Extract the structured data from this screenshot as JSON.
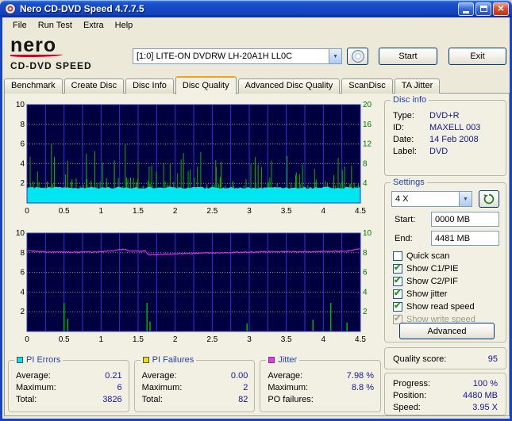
{
  "window": {
    "title": "Nero CD-DVD Speed 4.7.7.5"
  },
  "menu": {
    "items": [
      "File",
      "Run Test",
      "Extra",
      "Help"
    ]
  },
  "logo": {
    "brand": "nero",
    "product": "CD-DVD SPEED"
  },
  "toolbar": {
    "drive": "[1:0]  LITE-ON DVDRW LH-20A1H LL0C",
    "start": "Start",
    "exit": "Exit"
  },
  "tabs": [
    {
      "label": "Benchmark",
      "active": false
    },
    {
      "label": "Create Disc",
      "active": false
    },
    {
      "label": "Disc Info",
      "active": false
    },
    {
      "label": "Disc Quality",
      "active": true
    },
    {
      "label": "Advanced Disc Quality",
      "active": false
    },
    {
      "label": "ScanDisc",
      "active": false
    },
    {
      "label": "TA Jitter",
      "active": false
    }
  ],
  "disc_info": {
    "title": "Disc info",
    "rows": [
      {
        "label": "Type:",
        "value": "DVD+R"
      },
      {
        "label": "ID:",
        "value": "MAXELL 003"
      },
      {
        "label": "Date:",
        "value": "14 Feb 2008"
      },
      {
        "label": "Label:",
        "value": "DVD"
      }
    ]
  },
  "settings": {
    "title": "Settings",
    "speed_value": "4 X",
    "start_label": "Start:",
    "start_value": "0000 MB",
    "end_label": "End:",
    "end_value": "4481 MB",
    "checkboxes": [
      {
        "label": "Quick scan",
        "checked": false,
        "disabled": false
      },
      {
        "label": "Show C1/PIE",
        "checked": true,
        "disabled": false
      },
      {
        "label": "Show C2/PIF",
        "checked": true,
        "disabled": false
      },
      {
        "label": "Show jitter",
        "checked": true,
        "disabled": false
      },
      {
        "label": "Show read speed",
        "checked": true,
        "disabled": false
      },
      {
        "label": "Show write speed",
        "checked": true,
        "disabled": true
      }
    ],
    "advanced_button": "Advanced"
  },
  "quality_score": {
    "label": "Quality score:",
    "value": "95"
  },
  "progress_info": {
    "rows": [
      {
        "label": "Progress:",
        "value": "100 %"
      },
      {
        "label": "Position:",
        "value": "4480 MB"
      },
      {
        "label": "Speed:",
        "value": "3.95 X"
      }
    ]
  },
  "stats_boxes": [
    {
      "title": "PI Errors",
      "color": "#00E6F0",
      "rows": [
        {
          "label": "Average:",
          "value": "0.21"
        },
        {
          "label": "Maximum:",
          "value": "6"
        },
        {
          "label": "Total:",
          "value": "3826"
        }
      ]
    },
    {
      "title": "PI Failures",
      "color": "#F0E000",
      "rows": [
        {
          "label": "Average:",
          "value": "0.00"
        },
        {
          "label": "Maximum:",
          "value": "2"
        },
        {
          "label": "Total:",
          "value": "82"
        }
      ]
    },
    {
      "title": "Jitter",
      "color": "#FF2CFF",
      "rows": [
        {
          "label": "Average:",
          "value": "7.98 %"
        },
        {
          "label": "Maximum:",
          "value": "8.8 %"
        },
        {
          "label": "PO failures:",
          "value": ""
        }
      ]
    }
  ],
  "chart_data": [
    {
      "id": "pi-errors-chart",
      "type": "area+spikes",
      "x_min": 0,
      "x_max": 4.5,
      "grid_x_step": 0.25,
      "x_ticks": [
        0,
        0.5,
        1,
        1.5,
        2,
        2.5,
        3,
        3.5,
        4,
        4.5
      ],
      "y_min": 0,
      "y_max": 10,
      "y_ticks_left": [
        2,
        4,
        6,
        8,
        10
      ],
      "y_ticks_right": [
        4,
        8,
        12,
        16,
        20
      ],
      "bg": "#000040",
      "grid_v_color": "#3333CC",
      "grid_h_color": "#9090A8",
      "border_color": "#3333CC",
      "label_color": "#000000",
      "right_label_color": "#007800",
      "series": [
        {
          "kind": "spikes-random",
          "name": "pi-errors-spikes",
          "color": "#00B400",
          "seed": 42,
          "count": 420,
          "base": 0.3,
          "scale": 0.9,
          "max": 6,
          "extra": [
            [
              0.33,
              6.0
            ],
            [
              0.37,
              4.7
            ],
            [
              0.55,
              4.3
            ],
            [
              0.8,
              5.0
            ],
            [
              1.02,
              4.1
            ],
            [
              1.18,
              3.8
            ],
            [
              1.5,
              4.2
            ],
            [
              2.08,
              4.4
            ],
            [
              2.3,
              3.7
            ],
            [
              2.62,
              4.2
            ],
            [
              3.12,
              3.9
            ],
            [
              3.3,
              4.3
            ],
            [
              3.72,
              3.9
            ],
            [
              4.2,
              4.6
            ],
            [
              4.38,
              3.8
            ]
          ]
        },
        {
          "kind": "area",
          "name": "read-speed-area",
          "color": "#00E6F0",
          "seed": 9,
          "level": 1.55,
          "noise": 0.1,
          "step": 0.025
        }
      ],
      "summary": {
        "pi_errors_average": 0.21,
        "pi_errors_maximum": 6,
        "pi_errors_total": 3826
      }
    },
    {
      "id": "jitter-chart",
      "type": "line+spikes",
      "x_min": 0,
      "x_max": 4.5,
      "grid_x_step": 0.25,
      "x_ticks": [
        0,
        0.5,
        1,
        1.5,
        2,
        2.5,
        3,
        3.5,
        4,
        4.5
      ],
      "y_min": 0,
      "y_max": 10,
      "y_ticks_left": [
        2,
        4,
        6,
        8,
        10
      ],
      "y_ticks_right": [
        2,
        4,
        6,
        8,
        10
      ],
      "bg": "#000040",
      "grid_v_color": "#3333CC",
      "grid_h_color": "#9090A8",
      "border_color": "#3333CC",
      "label_color": "#000000",
      "right_label_color": "#007800",
      "series": [
        {
          "kind": "spikes-list",
          "name": "pi-failures-spikes",
          "color": "#00B400",
          "width": 1.5,
          "points": [
            [
              0.5,
              2.9
            ],
            [
              0.55,
              1.3
            ],
            [
              1.62,
              2.9
            ],
            [
              1.66,
              1.0
            ],
            [
              2.97,
              0.8
            ],
            [
              3.86,
              1.2
            ],
            [
              4.1,
              2.9
            ],
            [
              4.32,
              0.9
            ]
          ]
        },
        {
          "kind": "line",
          "name": "jitter-line",
          "color": "#FF2CFF",
          "seed": 13,
          "step": 0.012,
          "noise": 0.055,
          "points": [
            [
              0,
              8.2
            ],
            [
              0.25,
              8.1
            ],
            [
              0.6,
              8.05
            ],
            [
              1.0,
              8.1
            ],
            [
              1.3,
              8.35
            ],
            [
              1.45,
              8.15
            ],
            [
              1.6,
              8.2
            ],
            [
              1.63,
              7.8
            ],
            [
              2.0,
              7.9
            ],
            [
              2.6,
              8.0
            ],
            [
              3.2,
              8.1
            ],
            [
              3.8,
              8.1
            ],
            [
              4.3,
              8.15
            ],
            [
              4.5,
              8.4
            ]
          ]
        }
      ],
      "summary": {
        "jitter_average": "7.98 %",
        "jitter_maximum": "8.8 %"
      }
    }
  ]
}
